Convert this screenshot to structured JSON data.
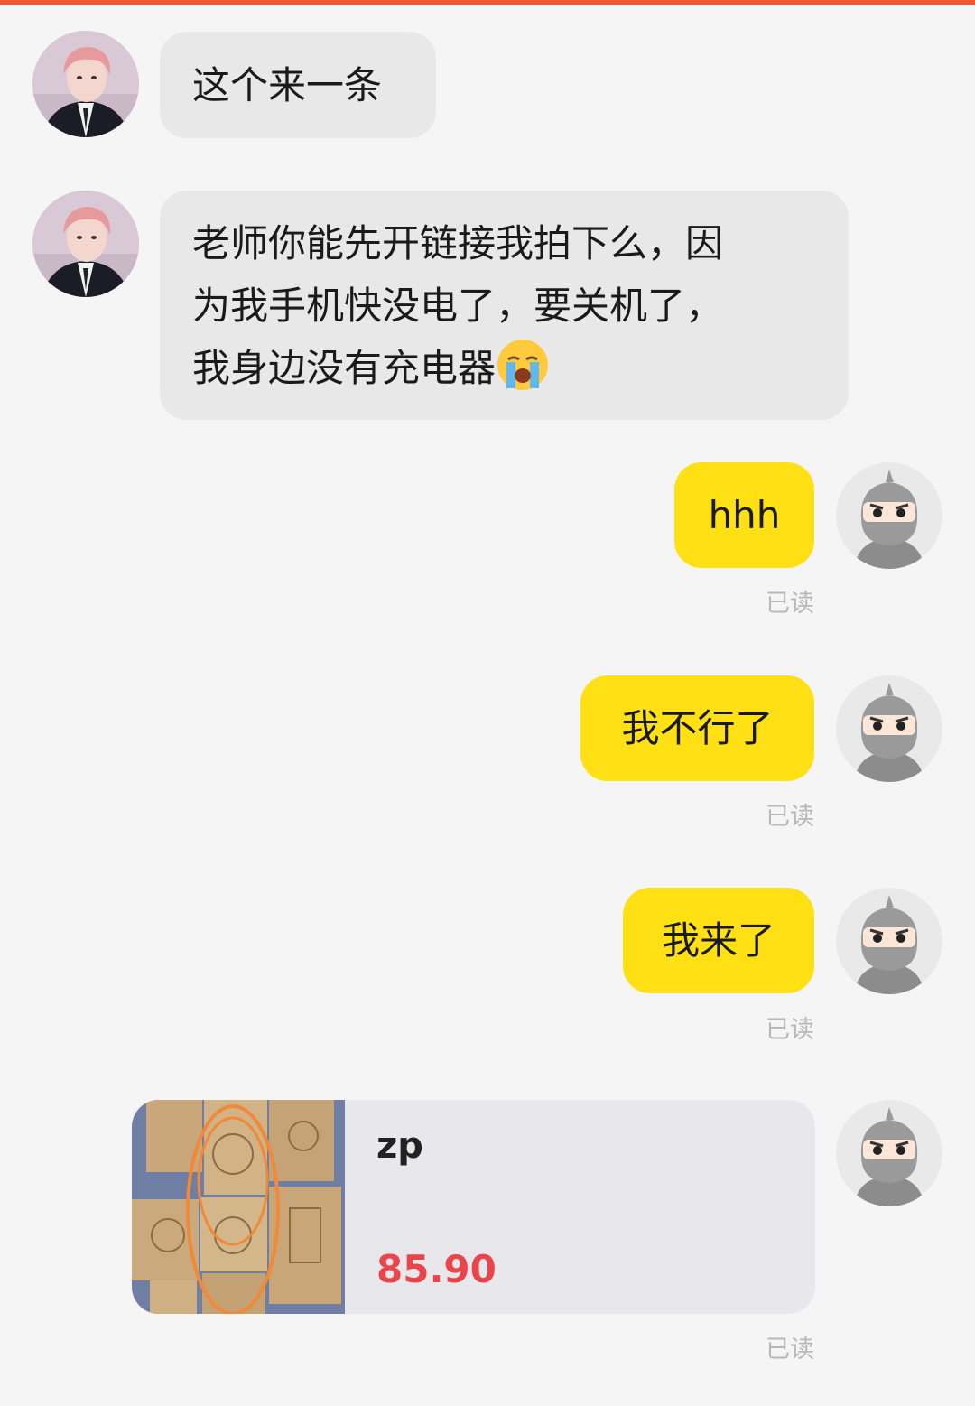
{
  "colors": {
    "accent_bar": "#f5572c",
    "incoming_bubble": "#e8e8e8",
    "outgoing_bubble": "#ffe014",
    "price": "#e8464b",
    "read_receipt": "#b8b8b8"
  },
  "messages": [
    {
      "id": "m1",
      "direction": "incoming",
      "text": "这个来一条",
      "avatar": "user-avatar"
    },
    {
      "id": "m2",
      "direction": "incoming",
      "lines": [
        "老师你能先开链接我拍下么，因",
        "为我手机快没电了，要关机了，",
        "我身边没有充电器"
      ],
      "emoji": "loudly-crying-face",
      "avatar": "user-avatar"
    },
    {
      "id": "m3",
      "direction": "outgoing",
      "text": "hhh",
      "status": "已读",
      "avatar": "seller-ninja-avatar"
    },
    {
      "id": "m4",
      "direction": "outgoing",
      "text": "我不行了",
      "status": "已读",
      "avatar": "seller-ninja-avatar"
    },
    {
      "id": "m5",
      "direction": "outgoing",
      "text": "我来了",
      "status": "已读",
      "avatar": "seller-ninja-avatar"
    }
  ],
  "product_card": {
    "name": "zp",
    "price": "85.90",
    "status": "已读",
    "thumbnail": "rubber-stamps-photo"
  }
}
